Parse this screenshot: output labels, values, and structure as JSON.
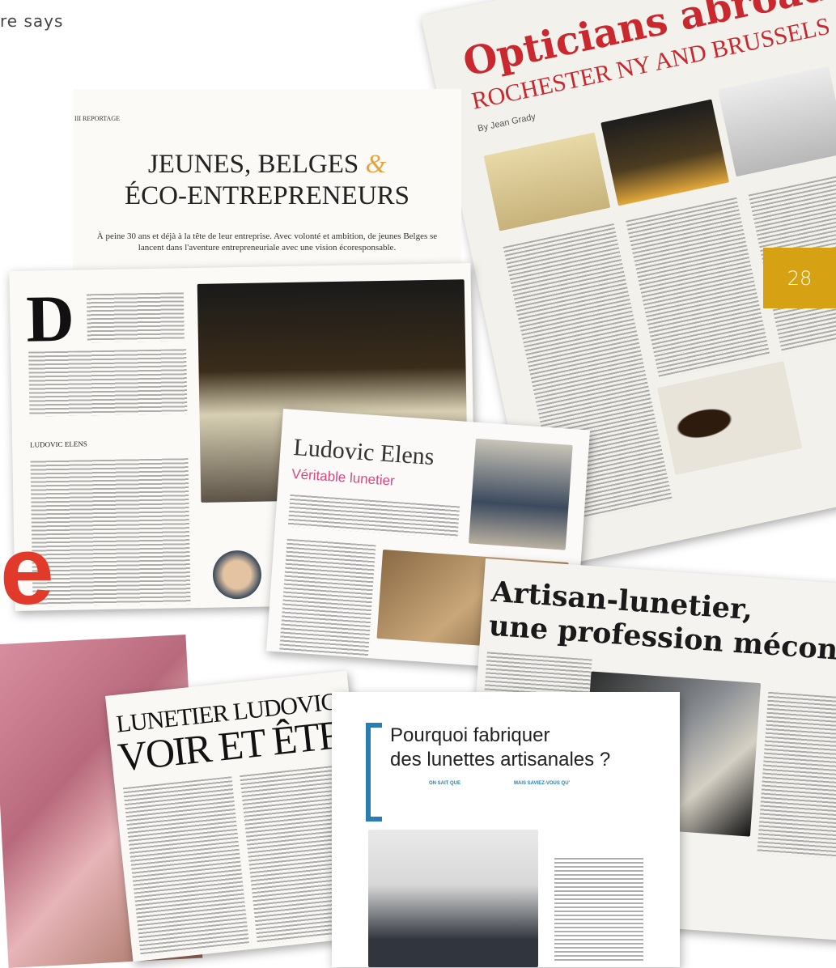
{
  "header": {
    "caption": "re says"
  },
  "page_number": "28",
  "clippings": {
    "opticians": {
      "title": "Opticians abroad:",
      "subtitle": "ROCHESTER NY AND BRUSSELS",
      "byline": "By Jean Grady"
    },
    "jeunes": {
      "kicker": "III REPORTAGE",
      "title_line1": "JEUNES, BELGES",
      "ampersand": "&",
      "title_line2": "ÉCO-ENTREPRENEURS",
      "lede": "À peine 30 ans et déjà à la tête de leur entreprise. Avec volonté et ambition, de jeunes Belges se lancent dans l'aventure entrepreneuriale avec une vision écoresponsable."
    },
    "article": {
      "dropcap": "D",
      "name": "LUDOVIC ELENS"
    },
    "pink": {
      "title": "Ludovic Elens",
      "subtitle": "Véritable lunetier"
    },
    "artisan": {
      "title_line1": "Artisan-lunetier,",
      "title_line2": "une profession méconnue"
    },
    "lunetier": {
      "title_line1": "LUNETIER LUDOVIC",
      "title_line2": "VOIR ET ÊTRE V"
    },
    "pourquoi": {
      "title_line1": "Pourquoi fabriquer",
      "title_line2": "des lunettes artisanales ?",
      "col1_label": "ON SAIT QUE",
      "col2_label": "MAIS SAVIEZ-VOUS QU'"
    }
  },
  "big_letter": "e",
  "colors": {
    "accent_red": "#c8282e",
    "badge_gold": "#d7a114",
    "pink": "#d9477f",
    "blue": "#2a7db1"
  }
}
